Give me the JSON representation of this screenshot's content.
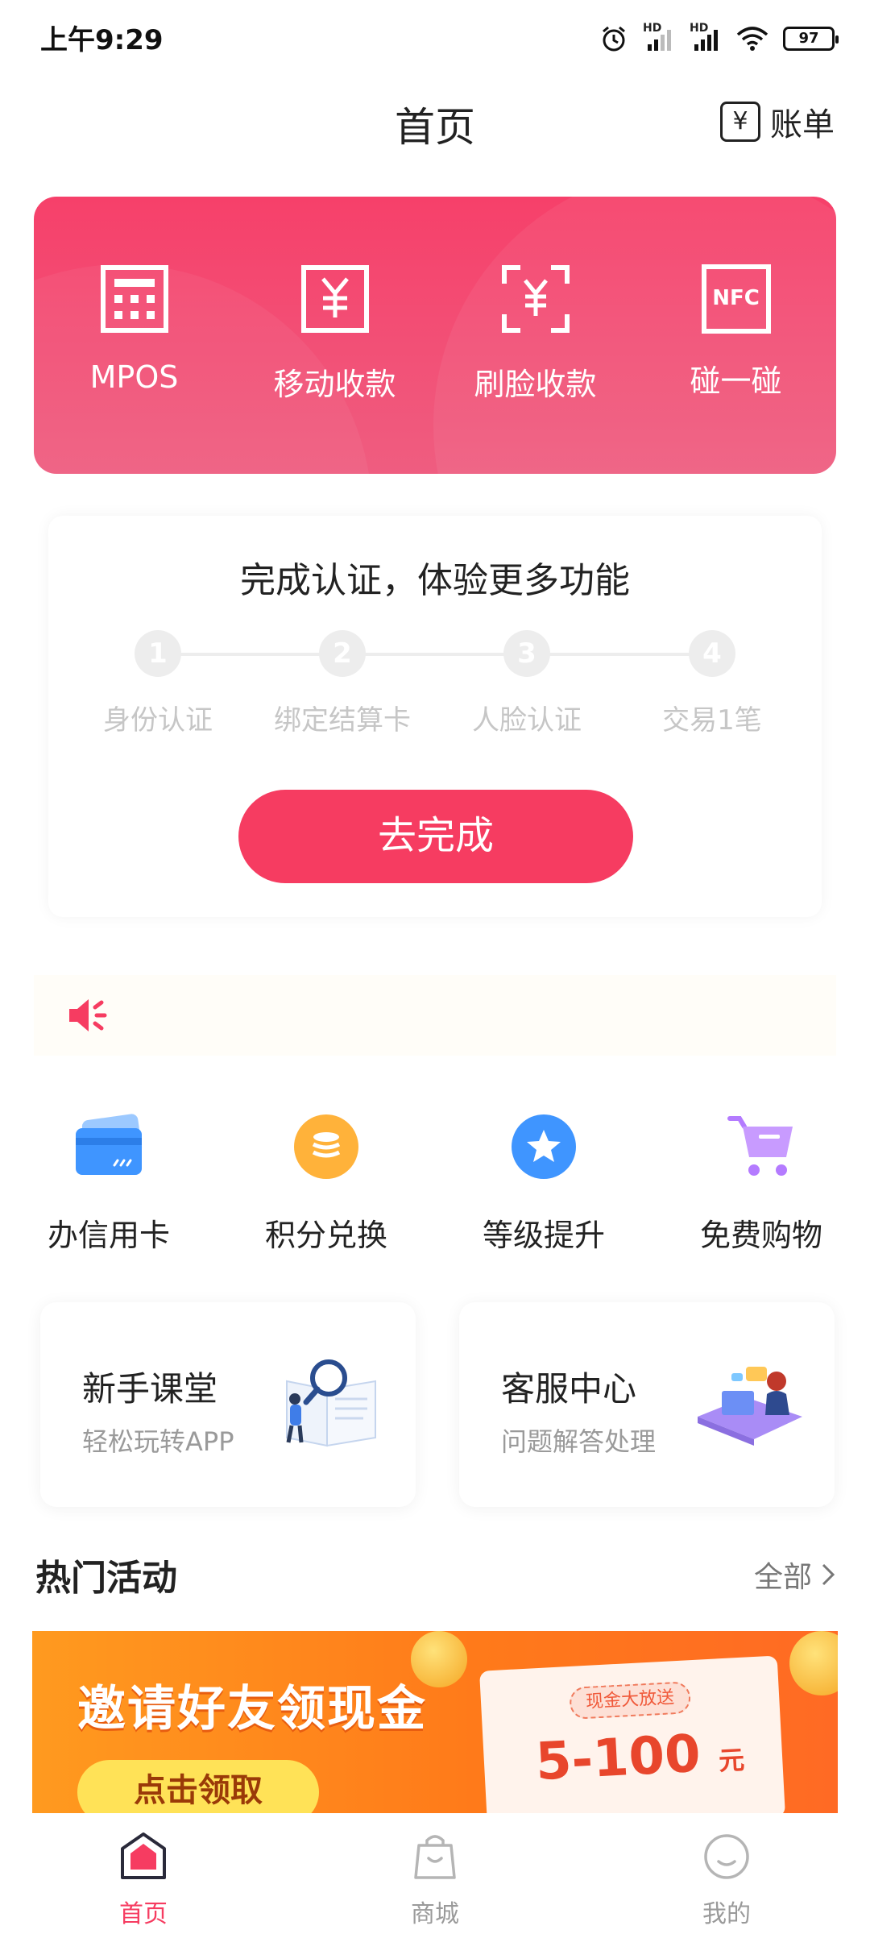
{
  "status_bar": {
    "time": "上午9:29",
    "battery": "97",
    "signal1": "HD",
    "signal2": "HD"
  },
  "header": {
    "title": "首页",
    "bill_icon": "¥",
    "bill_label": "账单"
  },
  "pay_card": {
    "items": [
      {
        "label": "MPOS",
        "icon": "calculator-icon"
      },
      {
        "label": "移动收款",
        "icon": "yen-receipt-icon"
      },
      {
        "label": "刷脸收款",
        "icon": "scan-yen-icon"
      },
      {
        "label": "碰一碰",
        "icon": "nfc-icon"
      }
    ],
    "nfc_text": "NFC"
  },
  "verify": {
    "title": "完成认证，体验更多功能",
    "steps": [
      {
        "num": "1",
        "label": "身份认证"
      },
      {
        "num": "2",
        "label": "绑定结算卡"
      },
      {
        "num": "3",
        "label": "人脸认证"
      },
      {
        "num": "4",
        "label": "交易1笔"
      }
    ],
    "button": "去完成"
  },
  "quick_menu": [
    {
      "label": "办信用卡",
      "icon": "credit-card-icon"
    },
    {
      "label": "积分兑换",
      "icon": "coins-icon"
    },
    {
      "label": "等级提升",
      "icon": "star-icon"
    },
    {
      "label": "免费购物",
      "icon": "cart-icon"
    }
  ],
  "promos": [
    {
      "title": "新手课堂",
      "subtitle": "轻松玩转APP"
    },
    {
      "title": "客服中心",
      "subtitle": "问题解答处理"
    }
  ],
  "hot": {
    "title": "热门活动",
    "more": "全部",
    "banner": {
      "title": "邀请好友领现金",
      "button": "点击领取",
      "tag": "现金大放送",
      "amount": "5-100",
      "unit": "元"
    }
  },
  "tabs": [
    {
      "label": "首页",
      "active": true
    },
    {
      "label": "商城",
      "active": false
    },
    {
      "label": "我的",
      "active": false
    }
  ],
  "colors": {
    "accent": "#f63c61",
    "card_pink": "#f6406a"
  }
}
